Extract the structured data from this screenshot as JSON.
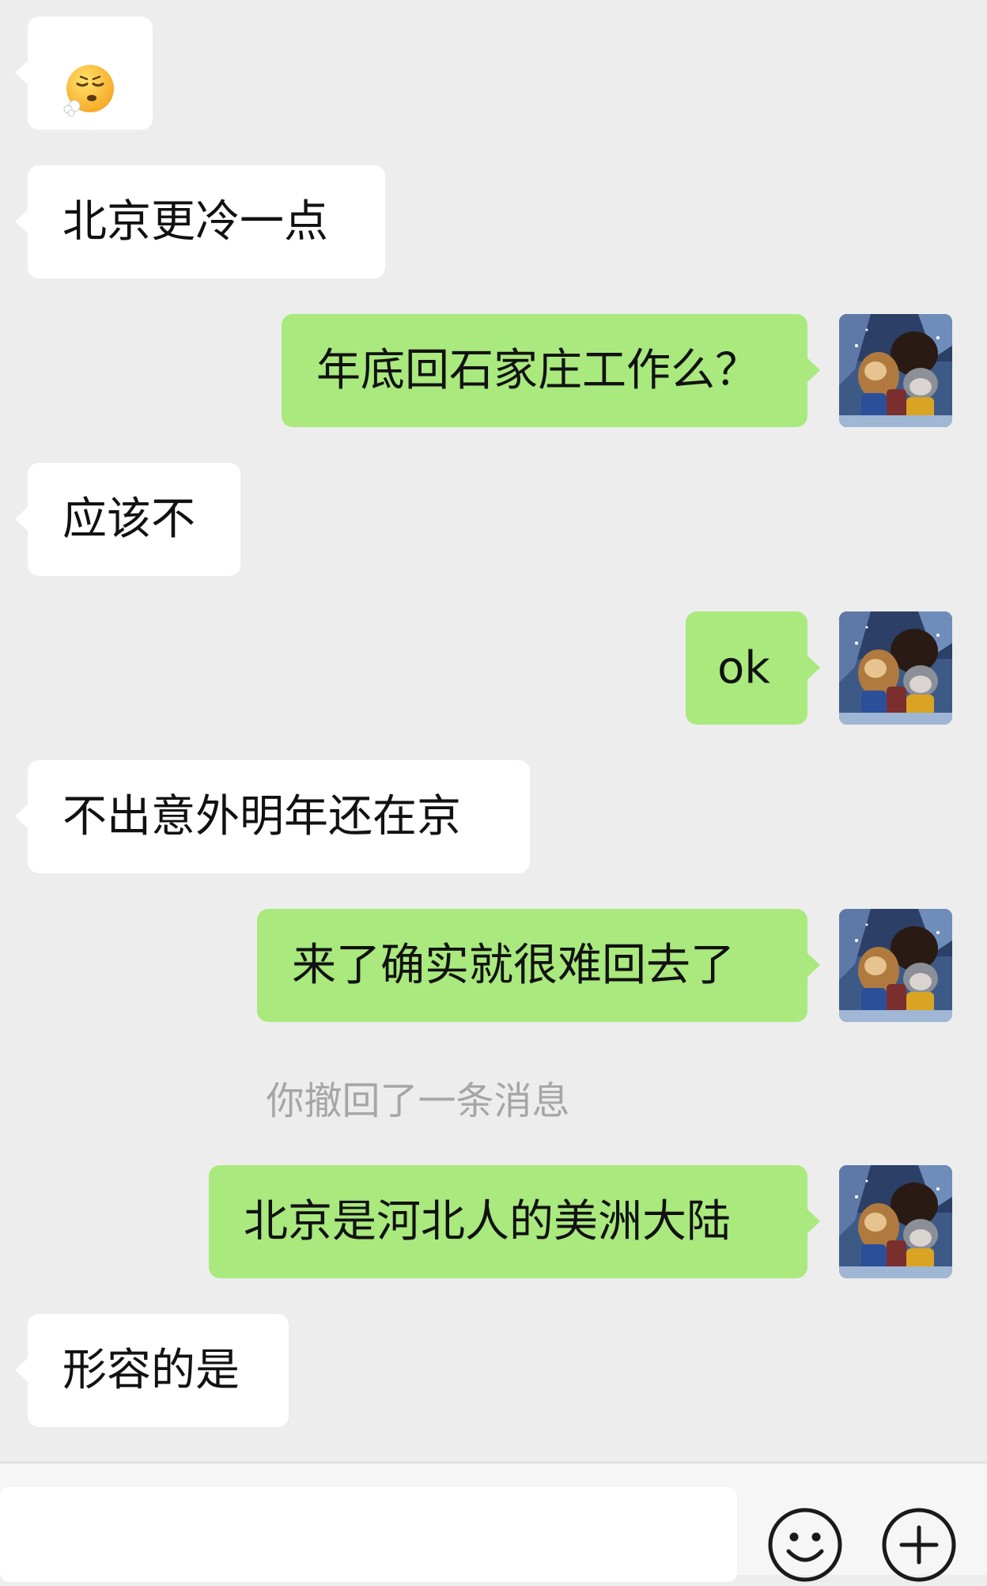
{
  "messages": [
    {
      "side": "in",
      "type": "emoji",
      "emoji": "face-exhaling-icon"
    },
    {
      "side": "in",
      "text": "北京更冷一点"
    },
    {
      "side": "out",
      "text": "年底回石家庄工作么？"
    },
    {
      "side": "in",
      "text": "应该不"
    },
    {
      "side": "out",
      "text": "ok"
    },
    {
      "side": "in",
      "text": "不出意外明年还在京"
    },
    {
      "side": "out",
      "text": "来了确实就很难回去了"
    },
    {
      "side": "system",
      "text": "你撤回了一条消息"
    },
    {
      "side": "out",
      "text": "北京是河北人的美洲大陆"
    },
    {
      "side": "in",
      "text": "形容的是"
    }
  ],
  "input_bar": {
    "value": "",
    "emoji_button_icon": "smiley-icon",
    "more_button_icon": "plus-circle-icon"
  },
  "colors": {
    "background": "#ededed",
    "incoming_bubble": "#ffffff",
    "outgoing_bubble": "#a9e97e",
    "system_text": "#a6a6a6"
  }
}
